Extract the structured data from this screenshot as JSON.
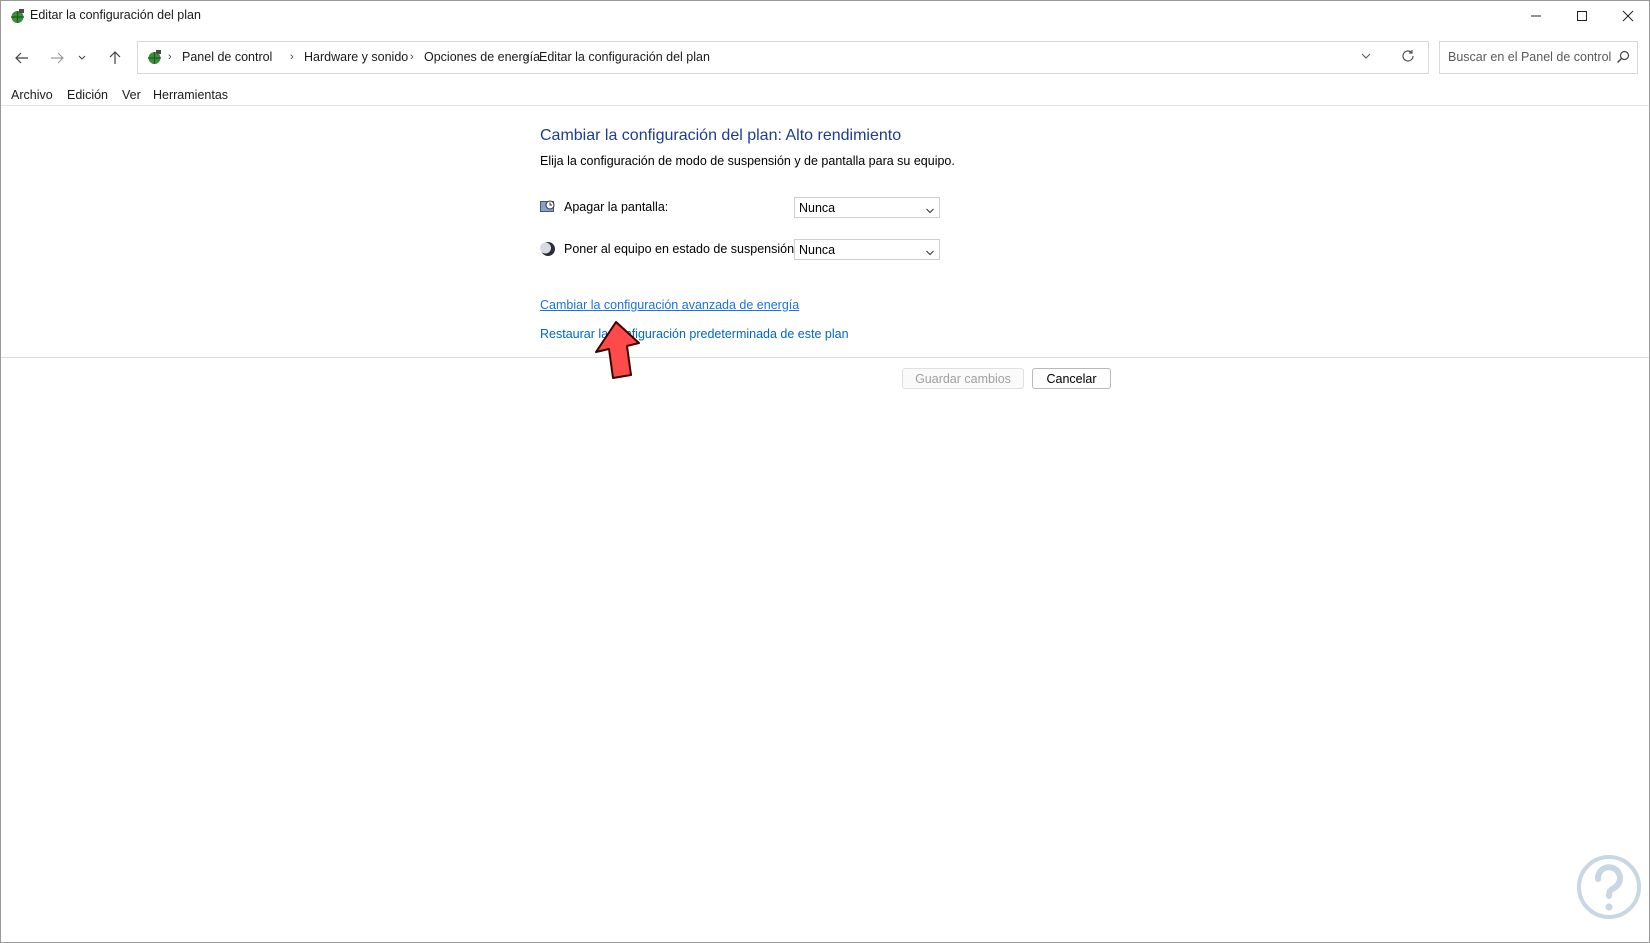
{
  "window": {
    "title": "Editar la configuración del plan"
  },
  "nav": {
    "breadcrumbs": [
      "Panel de control",
      "Hardware y sonido",
      "Opciones de energía",
      "Editar la configuración del plan"
    ],
    "search_placeholder": "Buscar en el Panel de control"
  },
  "menu": [
    "Archivo",
    "Edición",
    "Ver",
    "Herramientas"
  ],
  "main": {
    "heading": "Cambiar la configuración del plan: Alto rendimiento",
    "subtext": "Elija la configuración de modo de suspensión y de pantalla para su equipo.",
    "settings": [
      {
        "label": "Apagar la pantalla:",
        "value": "Nunca",
        "icon": "monitor-clock-icon"
      },
      {
        "label": "Poner al equipo en estado de suspensión:",
        "value": "Nunca",
        "icon": "moon-icon"
      }
    ],
    "link_advanced": "Cambiar la configuración avanzada de energía",
    "link_restore": "Restaurar la configuración predeterminada de este plan",
    "save_button": "Guardar cambios",
    "cancel_button": "Cancelar"
  },
  "colors": {
    "heading": "#1e3d8f",
    "link": "#0066cc",
    "arrow": "#ff4a4a"
  }
}
